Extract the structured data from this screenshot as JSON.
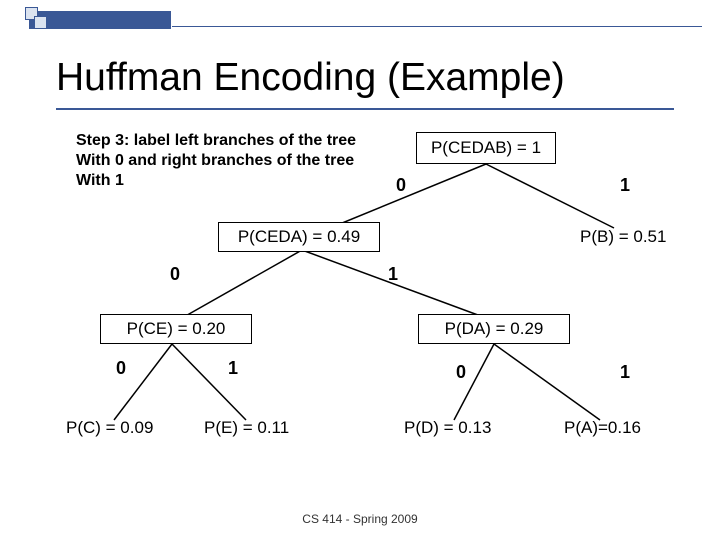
{
  "title": "Huffman Encoding (Example)",
  "step_text": "Step 3: label left branches of the tree\nWith 0 and right branches of the tree\nWith 1",
  "nodes": {
    "root": {
      "label": "P(CEDAB) = 1"
    },
    "ceda": {
      "label": "P(CEDA) = 0.49"
    },
    "b": {
      "label": "P(B) = 0.51"
    },
    "ce": {
      "label": "P(CE) = 0.20"
    },
    "da": {
      "label": "P(DA) = 0.29"
    },
    "c": {
      "label": "P(C) = 0.09"
    },
    "e": {
      "label": "P(E) = 0.11"
    },
    "d": {
      "label": "P(D) = 0.13"
    },
    "a": {
      "label": "P(A)=0.16"
    }
  },
  "edge_labels": {
    "root_left": "0",
    "root_right": "1",
    "ceda_left": "0",
    "ceda_right": "1",
    "ce_left": "0",
    "ce_right": "1",
    "da_left": "0",
    "da_right": "1"
  },
  "footer": "CS 414 - Spring 2009",
  "chart_data": {
    "type": "table",
    "title": "Huffman tree node probabilities",
    "series": [
      {
        "name": "P(C)",
        "values": [
          0.09
        ]
      },
      {
        "name": "P(E)",
        "values": [
          0.11
        ]
      },
      {
        "name": "P(D)",
        "values": [
          0.13
        ]
      },
      {
        "name": "P(A)",
        "values": [
          0.16
        ]
      },
      {
        "name": "P(CE)",
        "values": [
          0.2
        ]
      },
      {
        "name": "P(DA)",
        "values": [
          0.29
        ]
      },
      {
        "name": "P(CEDA)",
        "values": [
          0.49
        ]
      },
      {
        "name": "P(B)",
        "values": [
          0.51
        ]
      },
      {
        "name": "P(CEDAB)",
        "values": [
          1.0
        ]
      }
    ]
  }
}
